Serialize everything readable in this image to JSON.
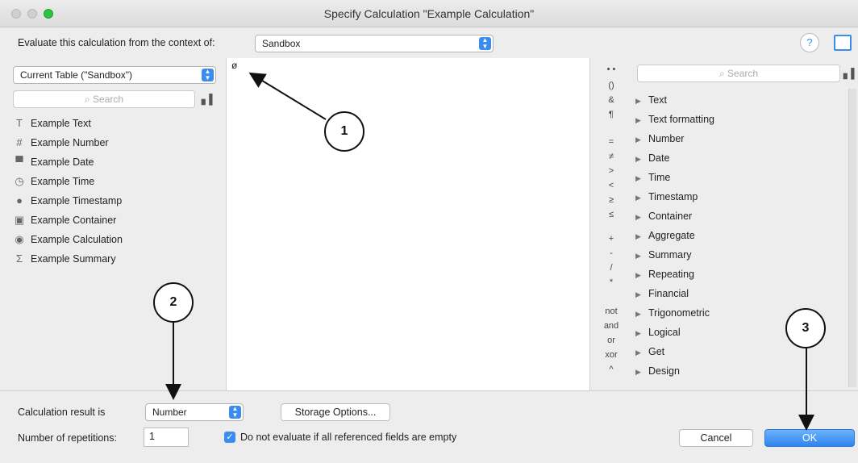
{
  "window": {
    "title": "Specify Calculation \"Example Calculation\""
  },
  "context": {
    "label": "Evaluate this calculation from the context of:",
    "value": "Sandbox",
    "help": "?"
  },
  "left": {
    "table_selector": "Current Table (\"Sandbox\")",
    "search_placeholder": "Search",
    "fields": [
      {
        "icon": "text-field-icon",
        "glyph": "T",
        "label": "Example Text"
      },
      {
        "icon": "number-field-icon",
        "glyph": "#",
        "label": "Example Number"
      },
      {
        "icon": "date-field-icon",
        "glyph": "▀",
        "label": "Example Date"
      },
      {
        "icon": "time-field-icon",
        "glyph": "◷",
        "label": "Example Time"
      },
      {
        "icon": "timestamp-field-icon",
        "glyph": "●",
        "label": "Example Timestamp"
      },
      {
        "icon": "container-field-icon",
        "glyph": "▣",
        "label": "Example Container"
      },
      {
        "icon": "calculation-field-icon",
        "glyph": "◉",
        "label": "Example Calculation"
      },
      {
        "icon": "summary-field-icon",
        "glyph": "Σ",
        "label": "Example Summary"
      }
    ]
  },
  "editor": {
    "cursor": "ø"
  },
  "operators": [
    "• •",
    "()",
    "&",
    "¶",
    "=",
    "≠",
    ">",
    "<",
    "≥",
    "≤",
    "+",
    "-",
    "/",
    "*",
    "not",
    "and",
    "or",
    "xor",
    "^"
  ],
  "right": {
    "search_placeholder": "Search",
    "functions": [
      "Text",
      "Text formatting",
      "Number",
      "Date",
      "Time",
      "Timestamp",
      "Container",
      "Aggregate",
      "Summary",
      "Repeating",
      "Financial",
      "Trigonometric",
      "Logical",
      "Get",
      "Design"
    ]
  },
  "bottom": {
    "result_label": "Calculation result is",
    "result_value": "Number",
    "storage_button": "Storage Options...",
    "repetitions_label": "Number of repetitions:",
    "repetitions_value": "1",
    "checkbox_label": "Do not evaluate if all referenced fields are empty",
    "cancel": "Cancel",
    "ok": "OK"
  },
  "callouts": [
    "1",
    "2",
    "3"
  ]
}
